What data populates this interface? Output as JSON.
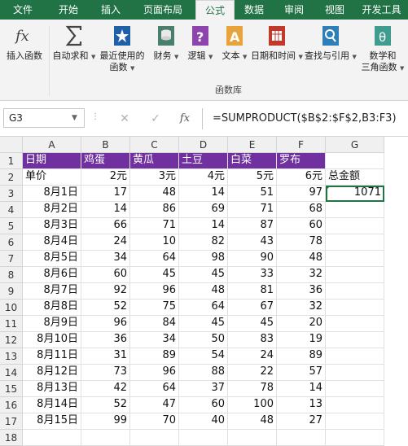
{
  "tabs": [
    "文件",
    "开始",
    "插入",
    "页面布局",
    "公式",
    "数据",
    "审阅",
    "视图",
    "开发工具"
  ],
  "active_tab": "公式",
  "ribbon": {
    "buttons": [
      {
        "label": "插入函数",
        "label2": "",
        "icon": "fx-icon"
      },
      {
        "label": "自动求和",
        "label2": "",
        "icon": "sigma-icon"
      },
      {
        "label": "最近使用的",
        "label2": "函数",
        "icon": "star-book-icon"
      },
      {
        "label": "财务",
        "label2": "",
        "icon": "coins-book-icon"
      },
      {
        "label": "逻辑",
        "label2": "",
        "icon": "question-book-icon"
      },
      {
        "label": "文本",
        "label2": "",
        "icon": "letter-a-book-icon"
      },
      {
        "label": "日期和时间",
        "label2": "",
        "icon": "calendar-book-icon"
      },
      {
        "label": "查找与引用",
        "label2": "",
        "icon": "magnifier-book-icon"
      },
      {
        "label": "数学和",
        "label2": "三角函数",
        "icon": "theta-book-icon"
      }
    ],
    "group_label": "函数库"
  },
  "formula_bar": {
    "name_box": "G3",
    "cancel": "✕",
    "enter": "✓",
    "fx": "fx",
    "formula": "=SUMPRODUCT($B$2:$F$2,B3:F3)"
  },
  "columns": [
    "A",
    "B",
    "C",
    "D",
    "E",
    "F",
    "G"
  ],
  "rows": [
    [
      "日期",
      "鸡蛋",
      "黄瓜",
      "土豆",
      "白菜",
      "罗布",
      ""
    ],
    [
      "单价",
      "2元",
      "3元",
      "4元",
      "5元",
      "6元",
      "总金额"
    ],
    [
      "8月1日",
      "17",
      "48",
      "14",
      "51",
      "97",
      "1071"
    ],
    [
      "8月2日",
      "14",
      "86",
      "69",
      "71",
      "68",
      ""
    ],
    [
      "8月3日",
      "66",
      "71",
      "14",
      "87",
      "60",
      ""
    ],
    [
      "8月4日",
      "24",
      "10",
      "82",
      "43",
      "78",
      ""
    ],
    [
      "8月5日",
      "34",
      "64",
      "98",
      "90",
      "48",
      ""
    ],
    [
      "8月6日",
      "60",
      "45",
      "45",
      "33",
      "32",
      ""
    ],
    [
      "8月7日",
      "92",
      "96",
      "48",
      "81",
      "36",
      ""
    ],
    [
      "8月8日",
      "52",
      "75",
      "64",
      "67",
      "32",
      ""
    ],
    [
      "8月9日",
      "96",
      "84",
      "45",
      "45",
      "20",
      ""
    ],
    [
      "8月10日",
      "36",
      "34",
      "50",
      "83",
      "19",
      ""
    ],
    [
      "8月11日",
      "31",
      "89",
      "54",
      "24",
      "89",
      ""
    ],
    [
      "8月12日",
      "73",
      "96",
      "88",
      "22",
      "57",
      ""
    ],
    [
      "8月13日",
      "42",
      "64",
      "37",
      "78",
      "14",
      ""
    ],
    [
      "8月14日",
      "52",
      "47",
      "60",
      "100",
      "13",
      ""
    ],
    [
      "8月15日",
      "99",
      "70",
      "40",
      "48",
      "27",
      ""
    ],
    [
      "",
      "",
      "",
      "",
      "",
      "",
      ""
    ]
  ],
  "colors": {
    "accent": "#217346",
    "header_fill": "#7030a0"
  }
}
